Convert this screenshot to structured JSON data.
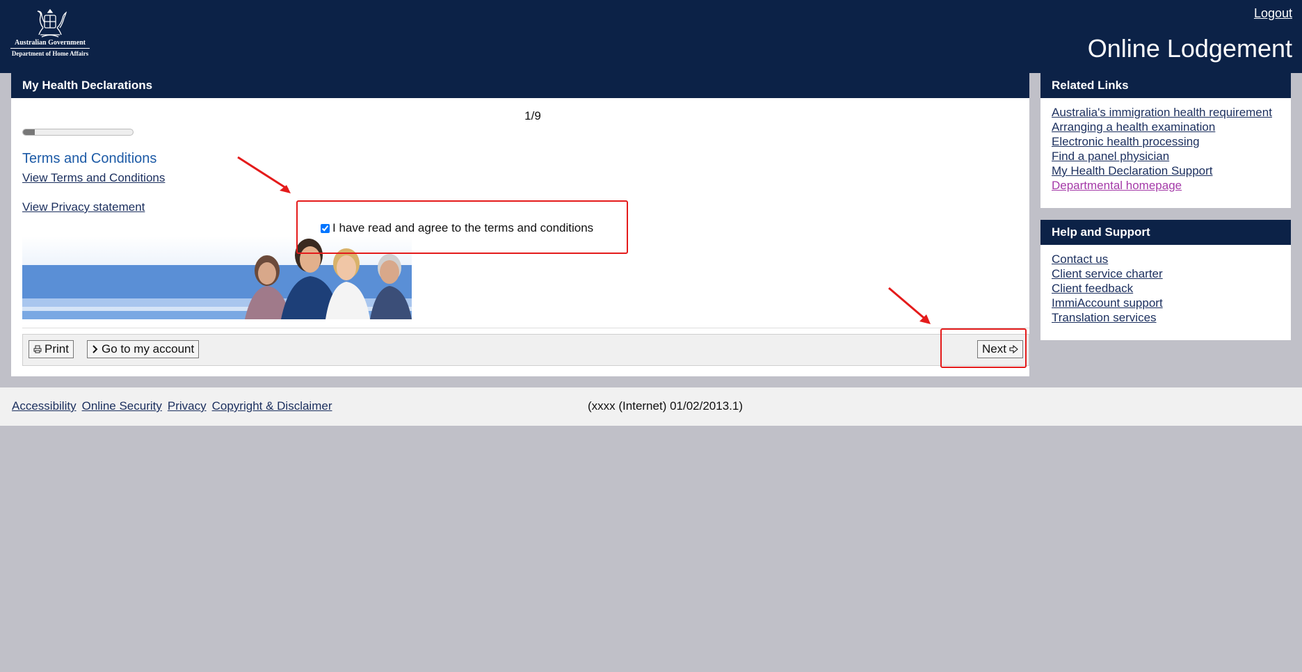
{
  "header": {
    "crest_line1": "Australian Government",
    "crest_line2": "Department of Home Affairs",
    "logout": "Logout",
    "title": "Online Lodgement"
  },
  "main": {
    "heading": "My Health Declarations",
    "step": "1/9",
    "progress_fraction": 0.11,
    "section_title": "Terms and Conditions",
    "view_terms": "View Terms and Conditions",
    "view_privacy": "View Privacy statement",
    "agree_label": "I have read and agree to the terms and conditions",
    "agree_checked": true
  },
  "buttons": {
    "print": "Print",
    "account": "Go to my account",
    "next": "Next"
  },
  "related": {
    "heading": "Related Links",
    "items": [
      "Australia's immigration health requirement",
      "Arranging a health examination",
      "Electronic health processing",
      "Find a panel physician",
      "My Health Declaration Support",
      "Departmental homepage"
    ]
  },
  "help": {
    "heading": "Help and Support",
    "items": [
      "Contact us",
      "Client service charter",
      "Client feedback",
      "ImmiAccount support",
      "Translation services"
    ]
  },
  "footer": {
    "links": [
      "Accessibility",
      "Online Security",
      "Privacy",
      "Copyright & Disclaimer"
    ],
    "version": "(xxxx (Internet) 01/02/2013.1)"
  },
  "colors": {
    "header_bg": "#0c2247",
    "page_bg": "#c0c0c8",
    "accent_title": "#1c5aa6",
    "annotation": "#e41b1b",
    "visited_link": "#a43aa8"
  },
  "icons": [
    "coat-of-arms-icon",
    "printer-icon",
    "chevron-right-icon",
    "arrow-right-icon"
  ]
}
